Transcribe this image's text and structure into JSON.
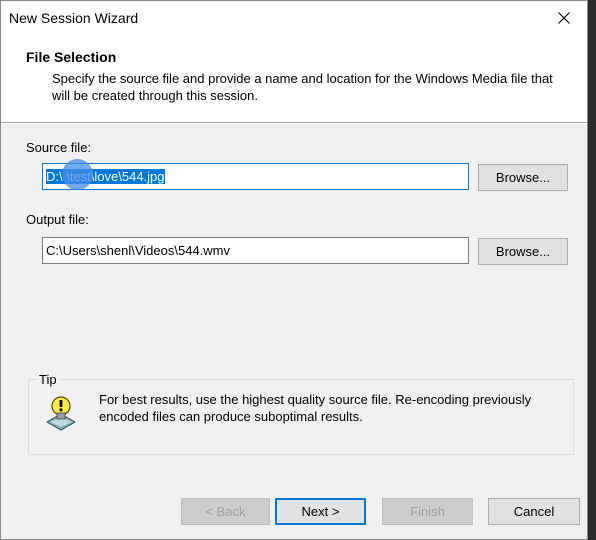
{
  "window": {
    "title": "New Session Wizard"
  },
  "header": {
    "title": "File Selection",
    "description": "Specify the source file and provide a name and location for the Windows Media file that will be created through this session."
  },
  "source": {
    "label": "Source file:",
    "value": "D:\\     \\test\\love\\544.jpg",
    "browse_label": "Browse..."
  },
  "output": {
    "label": "Output file:",
    "value": "C:\\Users\\shenl\\Videos\\544.wmv",
    "browse_label": "Browse..."
  },
  "tip": {
    "legend": "Tip",
    "text": "For best results, use the highest quality source file. Re-encoding previously encoded files can produce suboptimal results."
  },
  "footer": {
    "back_label": "< Back",
    "next_label": "Next >",
    "finish_label": "Finish",
    "cancel_label": "Cancel"
  },
  "colors": {
    "accent": "#0078d7",
    "dialog_bg": "#f0f0f0"
  },
  "icons": {
    "close": "close-icon",
    "tip": "tip-lightbulb-icon"
  }
}
